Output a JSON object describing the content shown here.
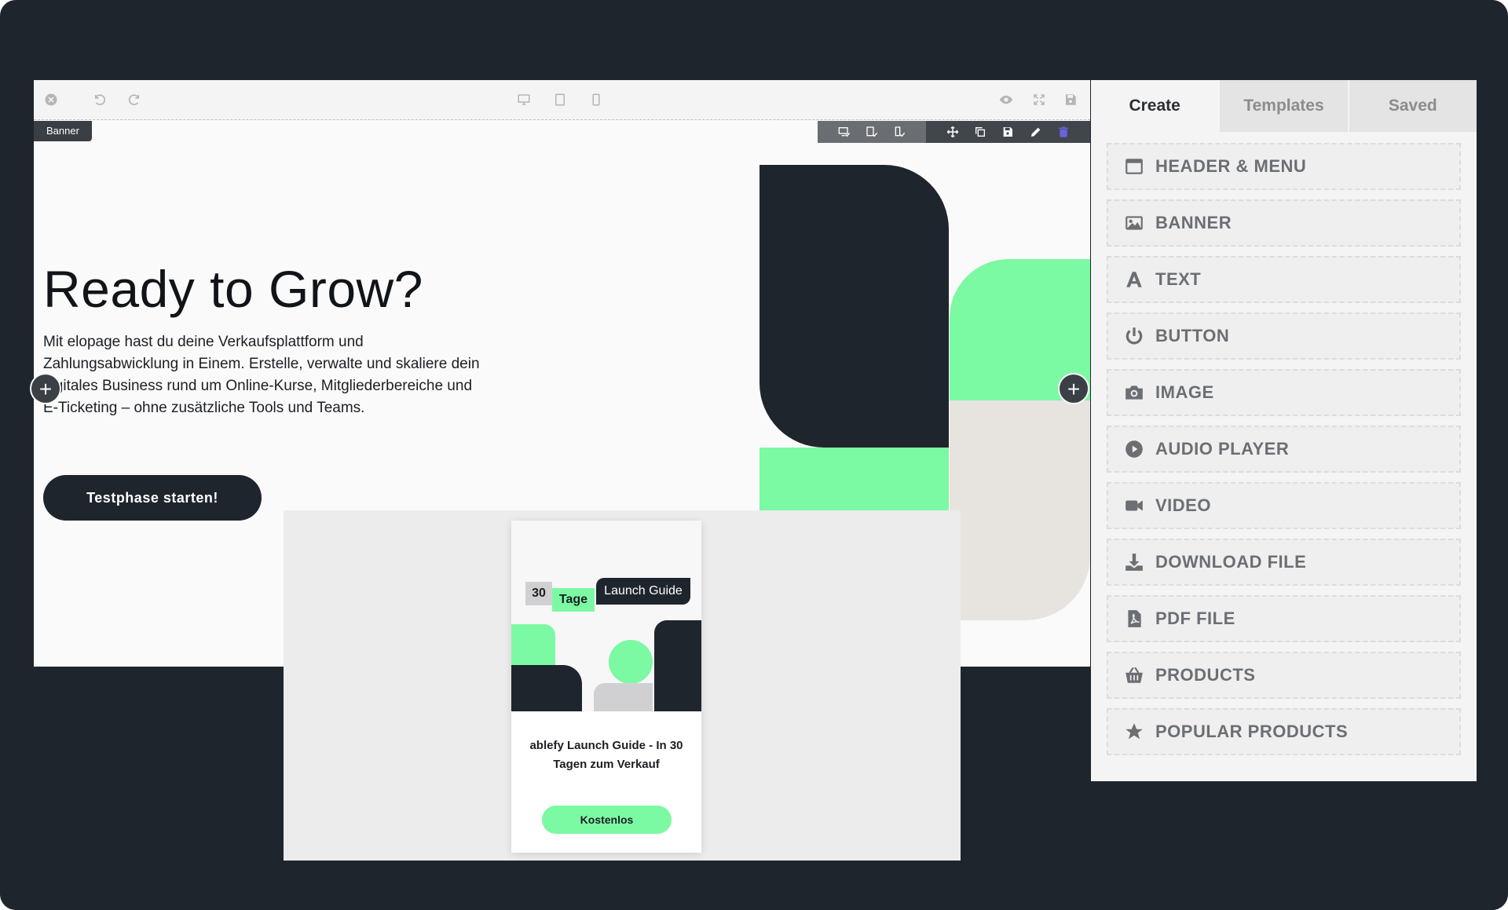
{
  "editor": {
    "block_label": "Banner",
    "hero": {
      "title": "Ready to Grow?",
      "text": "Mit elopage hast du deine Verkaufsplattform und Zahlungsabwicklung in Einem. Erstelle, verwalte und skaliere dein digitales Business rund um Online-Kurse, Mitgliederbereiche und E-Ticketing – ohne zusätzliche Tools und Teams.",
      "cta_label": "Testphase starten!"
    },
    "add_left": "+",
    "add_right": "+"
  },
  "product_card": {
    "badge_number": "30",
    "badge_days": "Tage",
    "badge_guide": "Launch Guide",
    "title": "ablefy Launch Guide - In 30 Tagen zum Verkauf",
    "button_label": "Kostenlos"
  },
  "panel": {
    "tabs": [
      {
        "label": "Create"
      },
      {
        "label": "Templates"
      },
      {
        "label": "Saved"
      }
    ],
    "items": [
      {
        "label": "HEADER & MENU",
        "icon": "window-icon"
      },
      {
        "label": "BANNER",
        "icon": "image-icon"
      },
      {
        "label": "TEXT",
        "icon": "font-icon"
      },
      {
        "label": "BUTTON",
        "icon": "power-icon"
      },
      {
        "label": "IMAGE",
        "icon": "camera-icon"
      },
      {
        "label": "AUDIO PLAYER",
        "icon": "play-icon"
      },
      {
        "label": "VIDEO",
        "icon": "video-camera-icon"
      },
      {
        "label": "DOWNLOAD FILE",
        "icon": "download-icon"
      },
      {
        "label": "PDF FILE",
        "icon": "pdf-file-icon"
      },
      {
        "label": "PRODUCTS",
        "icon": "basket-icon"
      },
      {
        "label": "POPULAR PRODUCTS",
        "icon": "star-icon"
      }
    ]
  },
  "colors": {
    "frame": "#1f252c",
    "accent_green": "#7cf9a3",
    "dark": "#1f252c",
    "beige": "#e7e4e0",
    "trash_accent": "#6b61e0"
  }
}
